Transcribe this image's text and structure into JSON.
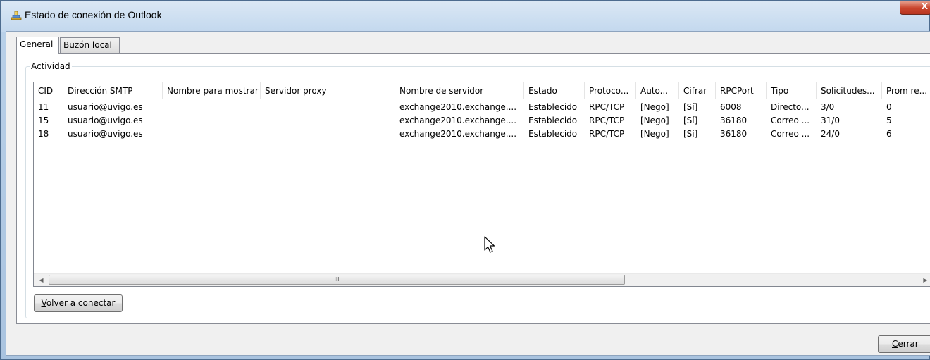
{
  "window": {
    "title": "Estado de conexión de Outlook",
    "close_glyph": "X",
    "icon": "outlook-connection-icon"
  },
  "tabs": [
    {
      "label": "General",
      "selected": true
    },
    {
      "label": "Buzón local",
      "selected": false
    }
  ],
  "group": {
    "label": "Actividad"
  },
  "table": {
    "columns": [
      "CID",
      "Dirección SMTP",
      "Nombre para mostrar",
      "Servidor proxy",
      "Nombre de servidor",
      "Estado",
      "Protoco...",
      "Auto...",
      "Cifrar",
      "RPCPort",
      "Tipo",
      "Solicitudes...",
      "Prom re..."
    ],
    "rows": [
      [
        "11",
        "usuario@uvigo.es",
        "",
        "",
        "exchange2010.exchange....",
        "Establecido",
        "RPC/TCP",
        "[Nego]",
        "[Sí]",
        "6008",
        "Directo...",
        "3/0",
        "0"
      ],
      [
        "15",
        "usuario@uvigo.es",
        "",
        "",
        "exchange2010.exchange....",
        "Establecido",
        "RPC/TCP",
        "[Nego]",
        "[Sí]",
        "36180",
        "Correo ...",
        "31/0",
        "5"
      ],
      [
        "18",
        "usuario@uvigo.es",
        "",
        "",
        "exchange2010.exchange....",
        "Establecido",
        "RPC/TCP",
        "[Nego]",
        "[Sí]",
        "36180",
        "Correo ...",
        "24/0",
        "6"
      ]
    ]
  },
  "scrollbar": {
    "left_arrow": "◀",
    "right_arrow": "▶",
    "grip": "III"
  },
  "buttons": {
    "reconnect": {
      "mnemonic": "V",
      "rest": "olver a conectar"
    },
    "close": {
      "mnemonic": "C",
      "rest": "errar"
    }
  }
}
